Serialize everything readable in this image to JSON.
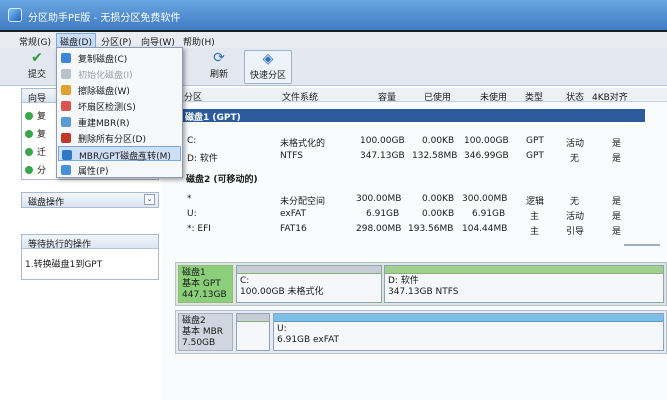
{
  "window": {
    "title": "分区助手PE版 - 无损分区免费软件"
  },
  "menubar": {
    "items": [
      "常规(G)",
      "磁盘(D)",
      "分区(P)",
      "向导(W)",
      "帮助(H)"
    ]
  },
  "toolbar": {
    "submit": "提交",
    "refresh": "刷新",
    "quick_partition": "快速分区"
  },
  "disk_menu": {
    "items": [
      {
        "label": "复制磁盘(C)",
        "icon": "copy-disk-icon",
        "disabled": false
      },
      {
        "label": "初始化磁盘(I)",
        "icon": "init-disk-icon",
        "disabled": true
      },
      {
        "label": "擦除磁盘(W)",
        "icon": "wipe-disk-icon",
        "disabled": false
      },
      {
        "label": "坏扇区检测(S)",
        "icon": "bad-sector-icon",
        "disabled": false
      },
      {
        "label": "重建MBR(R)",
        "icon": "rebuild-mbr-icon",
        "disabled": false
      },
      {
        "label": "删除所有分区(D)",
        "icon": "delete-partitions-icon",
        "disabled": false
      },
      {
        "label": "MBR/GPT磁盘互转(M)",
        "icon": "convert-disk-icon",
        "disabled": false
      },
      {
        "label": "属性(P)",
        "icon": "properties-icon",
        "disabled": false
      }
    ]
  },
  "left_panel": {
    "wizard_title": "向导",
    "wizard_items": [
      "复",
      "复",
      "迁",
      "分"
    ],
    "disk_ops_title": "磁盘操作",
    "pending_title": "等待执行的操作",
    "pending_items": [
      "1.转换磁盘1到GPT"
    ]
  },
  "table": {
    "columns": [
      "分区",
      "文件系统",
      "容量",
      "已使用",
      "未使用",
      "类型",
      "状态",
      "4KB对齐"
    ],
    "disks": [
      {
        "title": "磁盘1 (GPT)",
        "rows": [
          [
            "C:",
            "未格式化的",
            "100.00GB",
            "0.00KB",
            "100.00GB",
            "GPT",
            "活动",
            "是"
          ],
          [
            "D: 软件",
            "NTFS",
            "347.13GB",
            "132.58MB",
            "346.99GB",
            "GPT",
            "无",
            "是"
          ]
        ]
      },
      {
        "title": "磁盘2 (可移动的)",
        "rows": [
          [
            "*",
            "未分配空间",
            "300.00MB",
            "0.00KB",
            "300.00MB",
            "逻辑",
            "无",
            "是"
          ],
          [
            "U:",
            "exFAT",
            "6.91GB",
            "0.00KB",
            "6.91GB",
            "主",
            "活动",
            "是"
          ],
          [
            "*: EFI",
            "FAT16",
            "298.00MB",
            "193.56MB",
            "104.44MB",
            "主",
            "引导",
            "是"
          ]
        ]
      }
    ]
  },
  "disk_map": {
    "disk1": {
      "name": "磁盘1",
      "type": "基本 GPT",
      "size": "447.13GB",
      "partitions": [
        {
          "name": "C:",
          "detail": "100.00GB 未格式化"
        },
        {
          "name": "D: 软件",
          "detail": "347.13GB NTFS"
        }
      ]
    },
    "disk2": {
      "name": "磁盘2",
      "type": "基本 MBR",
      "size": "7.50GB",
      "partitions": [
        {
          "name": "U:",
          "detail": "6.91GB exFAT"
        }
      ]
    }
  }
}
